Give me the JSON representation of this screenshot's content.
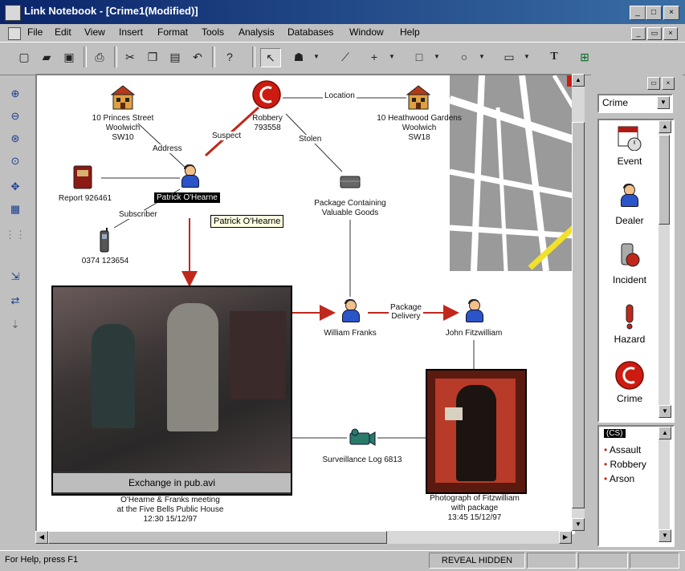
{
  "window": {
    "title": "Link Notebook - [Crime1(Modified)]"
  },
  "menu": [
    "File",
    "Edit",
    "View",
    "Insert",
    "Format",
    "Tools",
    "Analysis",
    "Databases",
    "Window",
    "Help"
  ],
  "canvas": {
    "nodes": {
      "address1": "10 Princes Street\nWoolwich\nSW10",
      "address2": "10 Heathwood Gardens\nWoolwich\nSW18",
      "robbery": "Robbery\n793558",
      "report": "Report 926461",
      "patrick": "Patrick O'Hearne",
      "phone": "0374 123654",
      "package": "Package Containing\nValuable Goods",
      "william": "William Franks",
      "john": "John Fitzwilliam",
      "surveillance": "Surveillance Log 6813",
      "video_caption": "O'Hearne & Franks meeting\nat the Five Bells Public House\n12:30 15/12/97",
      "photo_caption": "Photograph of Fitzwilliam\nwith package\n13:45 15/12/97",
      "video_file": "Exchange in pub.avi"
    },
    "edges": {
      "address": "Address",
      "suspect": "Suspect",
      "stolen": "Stolen",
      "location": "Location",
      "subscriber": "Subscriber",
      "package_delivery": "Package\nDelivery"
    },
    "tooltip": "Patrick O'Hearne"
  },
  "palette": {
    "combo": "Crime",
    "items": [
      "Event",
      "Dealer",
      "Incident",
      "Hazard",
      "Crime"
    ],
    "list_header": "(CS)",
    "list": [
      "Assault",
      "Robbery",
      "Arson"
    ]
  },
  "status": {
    "help": "For Help, press F1",
    "mode": "REVEAL HIDDEN"
  },
  "colors": {
    "title_start": "#0a246a",
    "accent_red": "#cc1b10",
    "map_gray": "#9a9a9a",
    "link_red": "#c0281c"
  }
}
